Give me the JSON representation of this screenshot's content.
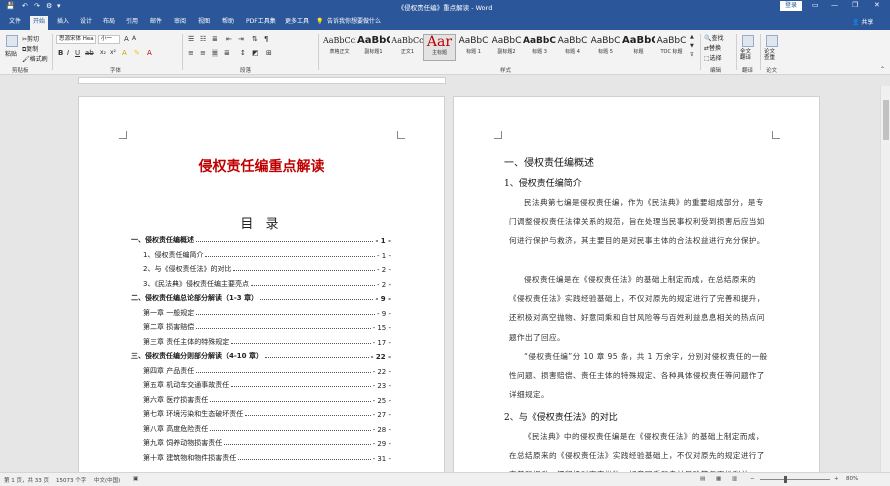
{
  "titlebar": {
    "title": "《侵权责任编》重点解读 - Word",
    "login_label": "登录",
    "quick_access": [
      "💾",
      "↶",
      "↷",
      "⚙",
      "▾"
    ],
    "window_buttons": [
      "▭",
      "—",
      "❐",
      "✕"
    ]
  },
  "tabs": [
    {
      "label": "文件"
    },
    {
      "label": "开始"
    },
    {
      "label": "插入"
    },
    {
      "label": "设计"
    },
    {
      "label": "布局"
    },
    {
      "label": "引用"
    },
    {
      "label": "邮件"
    },
    {
      "label": "审阅"
    },
    {
      "label": "视图"
    },
    {
      "label": "帮助"
    },
    {
      "label": "PDF工具集"
    },
    {
      "label": "更多工具"
    }
  ],
  "tellme": {
    "label": "告诉我你想要做什么"
  },
  "share": {
    "label": "共享"
  },
  "ribbon": {
    "clipboard": {
      "paste": "粘贴",
      "cut": "剪切",
      "copy": "复制",
      "format_painter": "格式刷",
      "group": "剪贴板"
    },
    "font": {
      "name": "思源宋体 Hea",
      "size": "小一",
      "group": "字体"
    },
    "paragraph": {
      "group": "段落"
    },
    "styles": {
      "group": "样式",
      "items": [
        {
          "preview": "AaBbCcI",
          "name": "表格正文"
        },
        {
          "preview": "AaBbC",
          "name": "副标题1"
        },
        {
          "preview": "AaBbCc",
          "name": "正文1"
        },
        {
          "preview": "Aar",
          "name": "主标题"
        },
        {
          "preview": "AaBbC",
          "name": "标题 1"
        },
        {
          "preview": "AaBbC",
          "name": "副标题2"
        },
        {
          "preview": "AaBbC",
          "name": "标题 3"
        },
        {
          "preview": "AaBbC",
          "name": "标题 4"
        },
        {
          "preview": "AaBbC",
          "name": "标题 5"
        },
        {
          "preview": "AaBbC",
          "name": "标题"
        },
        {
          "preview": "AaBbC",
          "name": "TOC 标题"
        }
      ]
    },
    "editing": {
      "find": "查找",
      "replace": "替换",
      "select": "选择",
      "group": "编辑"
    },
    "translate": {
      "full": "全文翻译",
      "group": "翻译"
    },
    "paper": {
      "check": "论文查重",
      "group": "论文"
    }
  },
  "page1": {
    "title": "侵权责任编重点解读",
    "mulu": "目 录",
    "toc": [
      {
        "text": "一、侵权责任编概述",
        "page": "- 1 -",
        "level": 1
      },
      {
        "text": "1、侵权责任编简介",
        "page": "- 1 -",
        "level": 2
      },
      {
        "text": "2、与《侵权责任法》的对比",
        "page": "- 2 -",
        "level": 2
      },
      {
        "text": "3、《民法典》侵权责任编主要亮点",
        "page": "- 2 -",
        "level": 2
      },
      {
        "text": "二、侵权责任编总论部分解读（1-3 章）",
        "page": "- 9 -",
        "level": 1
      },
      {
        "text": "第一章  一般规定",
        "page": "- 9 -",
        "level": 2
      },
      {
        "text": "第二章  损害赔偿",
        "page": "- 15 -",
        "level": 2
      },
      {
        "text": "第三章  责任主体的特殊规定",
        "page": "- 17 -",
        "level": 2
      },
      {
        "text": "三、侵权责任编分则部分解读（4-10 章）",
        "page": "- 22 -",
        "level": 1
      },
      {
        "text": "第四章    产品责任",
        "page": "- 22 -",
        "level": 2
      },
      {
        "text": "第五章    机动车交通事故责任",
        "page": "- 23 -",
        "level": 2
      },
      {
        "text": "第六章    医疗损害责任",
        "page": "- 25 -",
        "level": 2
      },
      {
        "text": "第七章    环境污染和生态破坏责任",
        "page": "- 27 -",
        "level": 2
      },
      {
        "text": "第八章    高度危险责任",
        "page": "- 28 -",
        "level": 2
      },
      {
        "text": "第九章    饲养动物损害责任",
        "page": "- 29 -",
        "level": 2
      },
      {
        "text": "第十章    建筑物和物件损害责任",
        "page": "- 31 -",
        "level": 2
      }
    ]
  },
  "page2": {
    "h1": "一、侵权责任编概述",
    "h2a": "1、侵权责任编简介",
    "para1": "民法典第七编是侵权责任编，作为《民法典》的重要组成部分，是专门调整侵权责任法律关系的规范，旨在处理当民事权利受到损害后应当如何进行保护与救济，其主要目的是对民事主体的合法权益进行充分保护。",
    "para2": "侵权责任编是在《侵权责任法》的基础上制定而成，在总结原来的《侵权责任法》实践经验基础上，不仅对原先的规定进行了完善和提升，还积极对高空抛物、好意同乘和自甘风险等与百姓利益息息相关的热点问题作出了回应。",
    "para3": "“侵权责任编”分 10 章 95 条，共 1 万余字，分别对侵权责任的一般性问题、损害赔偿、责任主体的特殊规定、各种具体侵权责任等问题作了详细规定。",
    "h2b": "2、与《侵权责任法》的对比",
    "para4": "《民法典》中的侵权责任编是在《侵权责任法》的基础上制定而成，在总结原来的《侵权责任法》实践经验基础上，不仅对原先的规定进行了完善和提升，还积极对高空抛物、好意同乘和自甘风险等与百姓利益"
  },
  "statusbar": {
    "page": "第 1 页，共 33 页",
    "words": "15073 个字",
    "lang": "中文(中国)",
    "zoom": "80%"
  }
}
